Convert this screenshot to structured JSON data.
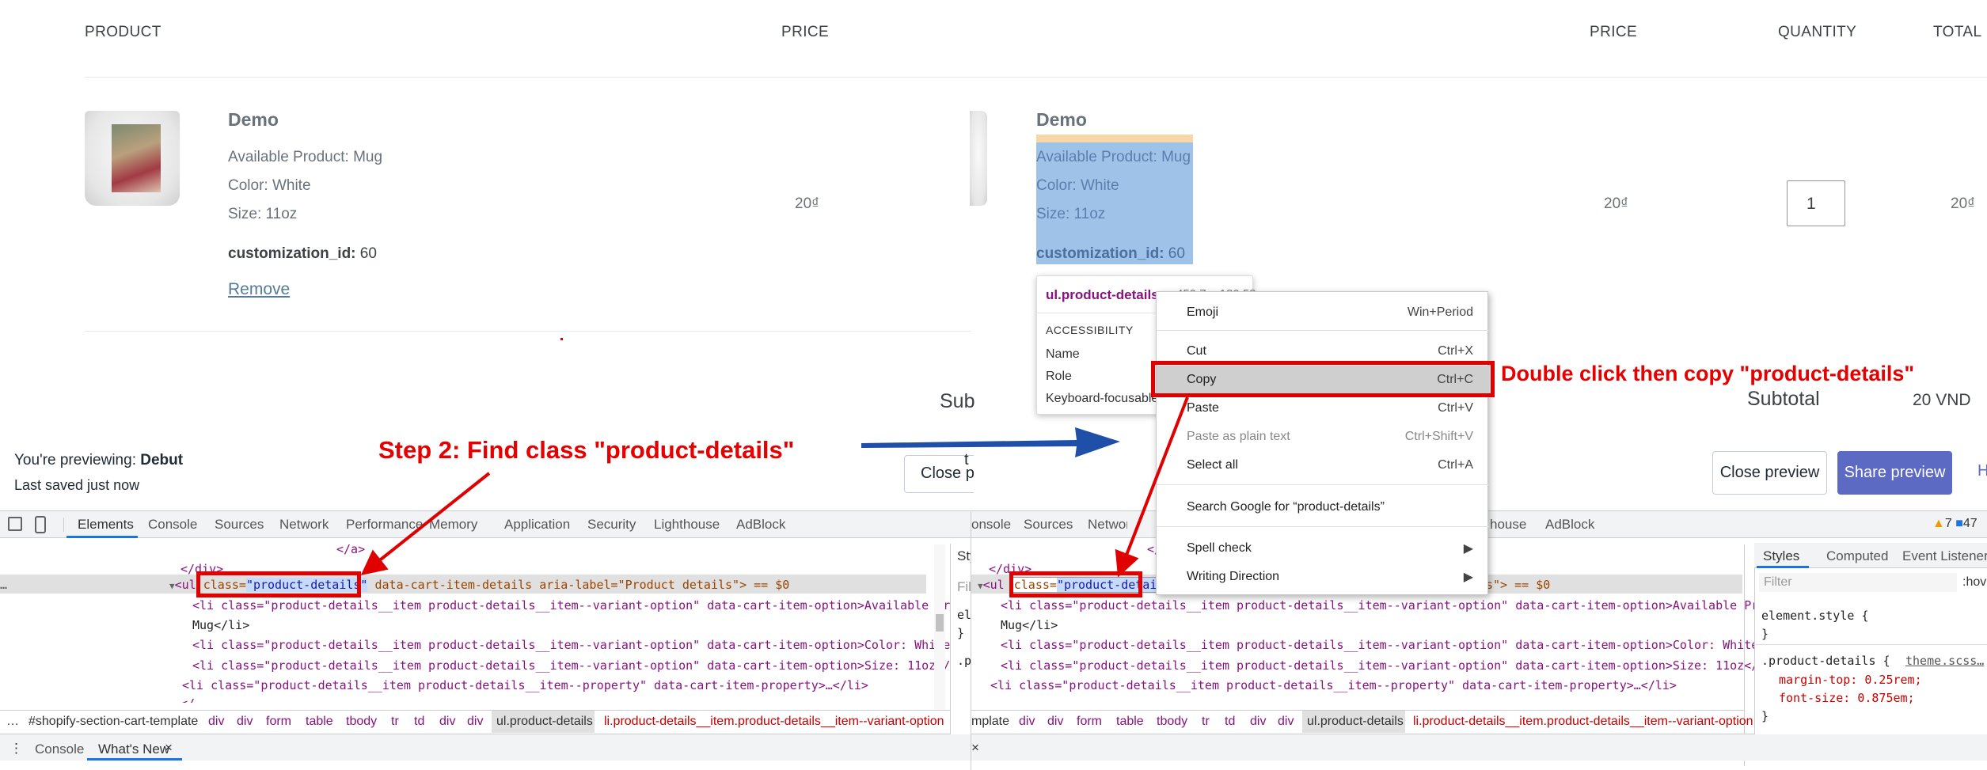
{
  "cart_left": {
    "header": {
      "product": "PRODUCT",
      "price": "PRICE"
    },
    "item": {
      "name": "Demo",
      "details": [
        "Available Product: Mug",
        "Color: White",
        "Size: 11oz"
      ],
      "prop_label": "customization_id:",
      "prop_value": "60",
      "remove": "Remove",
      "price": "20₫"
    }
  },
  "cart_right": {
    "header": {
      "price": "PRICE",
      "quantity": "QUANTITY",
      "total": "TOTAL"
    },
    "item": {
      "name": "Demo",
      "details": [
        "Available Product: Mug",
        "Color: White",
        "Size: 11oz"
      ],
      "prop_label": "customization_id:",
      "prop_value": "60",
      "price": "20₫",
      "qty": "1",
      "total": "20₫"
    },
    "subtotal_label": "Subtotal",
    "subtotal_value": "20 VND",
    "sub_cut": "Sub"
  },
  "preview_bar": {
    "previewing": "You're previewing:",
    "theme": "Debut",
    "saved": "Last saved just now",
    "close": "Close preview",
    "close_cut": "Close pr",
    "share": "Share preview",
    "extra": "H",
    "cut_t": "t"
  },
  "tooltip": {
    "selector": "ul.product-details",
    "size": "450.7 × 180.58",
    "accessibility": "ACCESSIBILITY",
    "rows": [
      "Name",
      "Role",
      "Keyboard-focusable"
    ]
  },
  "context_menu": {
    "items": [
      {
        "label": "Emoji",
        "shortcut": "Win+Period"
      },
      {
        "label": "Cut",
        "shortcut": "Ctrl+X"
      },
      {
        "label": "Copy",
        "shortcut": "Ctrl+C"
      },
      {
        "label": "Paste",
        "shortcut": "Ctrl+V"
      },
      {
        "label": "Paste as plain text",
        "shortcut": "Ctrl+Shift+V"
      },
      {
        "label": "Select all",
        "shortcut": "Ctrl+A"
      },
      {
        "label": "Search Google for “product-details”",
        "shortcut": ""
      },
      {
        "label": "Spell check",
        "shortcut": ""
      },
      {
        "label": "Writing Direction",
        "shortcut": ""
      }
    ]
  },
  "annotations": {
    "step2": "Step 2: Find class \"product-details\"",
    "copy": "Double click then copy \"product-details\""
  },
  "devtools_left": {
    "tabs": [
      "Elements",
      "Console",
      "Sources",
      "Network",
      "Performance",
      "Memory",
      "Application",
      "Security",
      "Lighthouse",
      "AdBlock"
    ],
    "code": {
      "close_a": "</a>",
      "close_div": "</div>",
      "ul_open": "<ul",
      "class_attr": "class=",
      "class_val": "\"product-details\"",
      "ul_rest": " data-cart-item-details aria-label=\"Product details\"> == $0",
      "li1": "<li class=\"product-details__item product-details__item--variant-option\" data-cart-item-option>Available Product:",
      "li1b": "Mug</li>",
      "li2": "<li class=\"product-details__item product-details__item--variant-option\" data-cart-item-option>Color: White</li>",
      "li3": "<li class=\"product-details__item product-details__item--variant-option\" data-cart-item-option>Size: 11oz</li>",
      "li4": "<li class=\"product-details__item product-details__item--property\" data-cart-item-property>…</li>",
      "cut": "</"
    },
    "breadcrumb": [
      "#shopify-section-cart-template",
      "div",
      "div",
      "form",
      "table",
      "tbody",
      "tr",
      "td",
      "div",
      "div",
      "ul.product-details",
      "li.product-details__item.product-details__item--variant-option"
    ],
    "drawer": [
      "Console",
      "What's New"
    ],
    "dots": "⋮",
    "close_x": "×",
    "ellipsis": "…"
  },
  "devtools_right": {
    "tabs": [
      "onsole",
      "Sources",
      "Network",
      "house",
      "AdBlock"
    ],
    "issues": "7",
    "issues2": "47",
    "styles_tabs": [
      "Styles",
      "Computed",
      "Event Listeners"
    ],
    "filter": "Filter",
    "hov": ":hov",
    "element_style": "element.style {",
    "close_brace": "}",
    "rule_selector": ".product-details {",
    "rule_source": "theme.scss…",
    "rule_props": [
      "margin-top: 0.25rem;",
      "font-size: 0.875em;"
    ],
    "code": {
      "close_div": "</div>",
      "ul_rest": "s\"> == $0",
      "li1": "<li class=\"product-details__item product-details__item--variant-option\" data-cart-item-option>Available Product:",
      "li1b": "Mug</li>",
      "li2": "<li class=\"product-details__item product-details__item--variant-option\" data-cart-item-option>Color: White</li>",
      "li3": "<li class=\"product-details__item product-details__item--variant-option\" data-cart-item-option>Size: 11oz</li>",
      "li4": "<li class=\"product-details__item product-details__item--property\" data-cart-item-property>…</li>",
      "cut_slash": "</"
    },
    "mid_panel": {
      "tab": "Sty",
      "filter": "Filt",
      "ele": "ele",
      "brace": "}",
      "pr": ".pr"
    },
    "breadcrumb": [
      "mplate",
      "div",
      "div",
      "form",
      "table",
      "tbody",
      "tr",
      "td",
      "div",
      "div",
      "ul.product-details",
      "li.product-details__item.product-details__item--variant-option"
    ],
    "close_x": "×"
  },
  "colors": {
    "accent": "#557b97",
    "share": "#5c6ac4",
    "annotation": "#e00000",
    "selection": "#bcd4f0"
  }
}
